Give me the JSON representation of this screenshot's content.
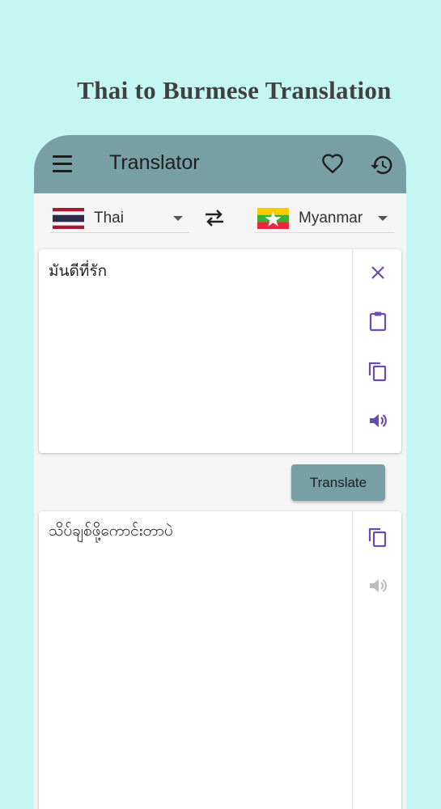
{
  "promo": {
    "title": "Thai to Burmese Translation"
  },
  "appbar": {
    "title": "Translator",
    "icons": [
      "menu-icon",
      "heart-icon",
      "history-icon"
    ],
    "color": "#78a0a4"
  },
  "languages": {
    "source": {
      "name": "Thai",
      "flag": "thailand-flag-icon"
    },
    "target": {
      "name": "Myanmar",
      "flag": "myanmar-flag-icon"
    },
    "swap_icon": "swap-arrows-icon"
  },
  "input": {
    "text": "มันดีที่รัก",
    "actions": [
      "close-icon",
      "clipboard-paste-icon",
      "copy-icon",
      "speaker-icon"
    ]
  },
  "translate_button": {
    "label": "Translate"
  },
  "output": {
    "text": "သိပ်ချစ်ဖို့ကောင်းတာပဲ",
    "actions": [
      "copy-icon",
      "speaker-icon"
    ]
  },
  "colors": {
    "background": "#c4f6f2",
    "accent": "#78a0a4",
    "icon_purple": "#6a4bb0"
  }
}
